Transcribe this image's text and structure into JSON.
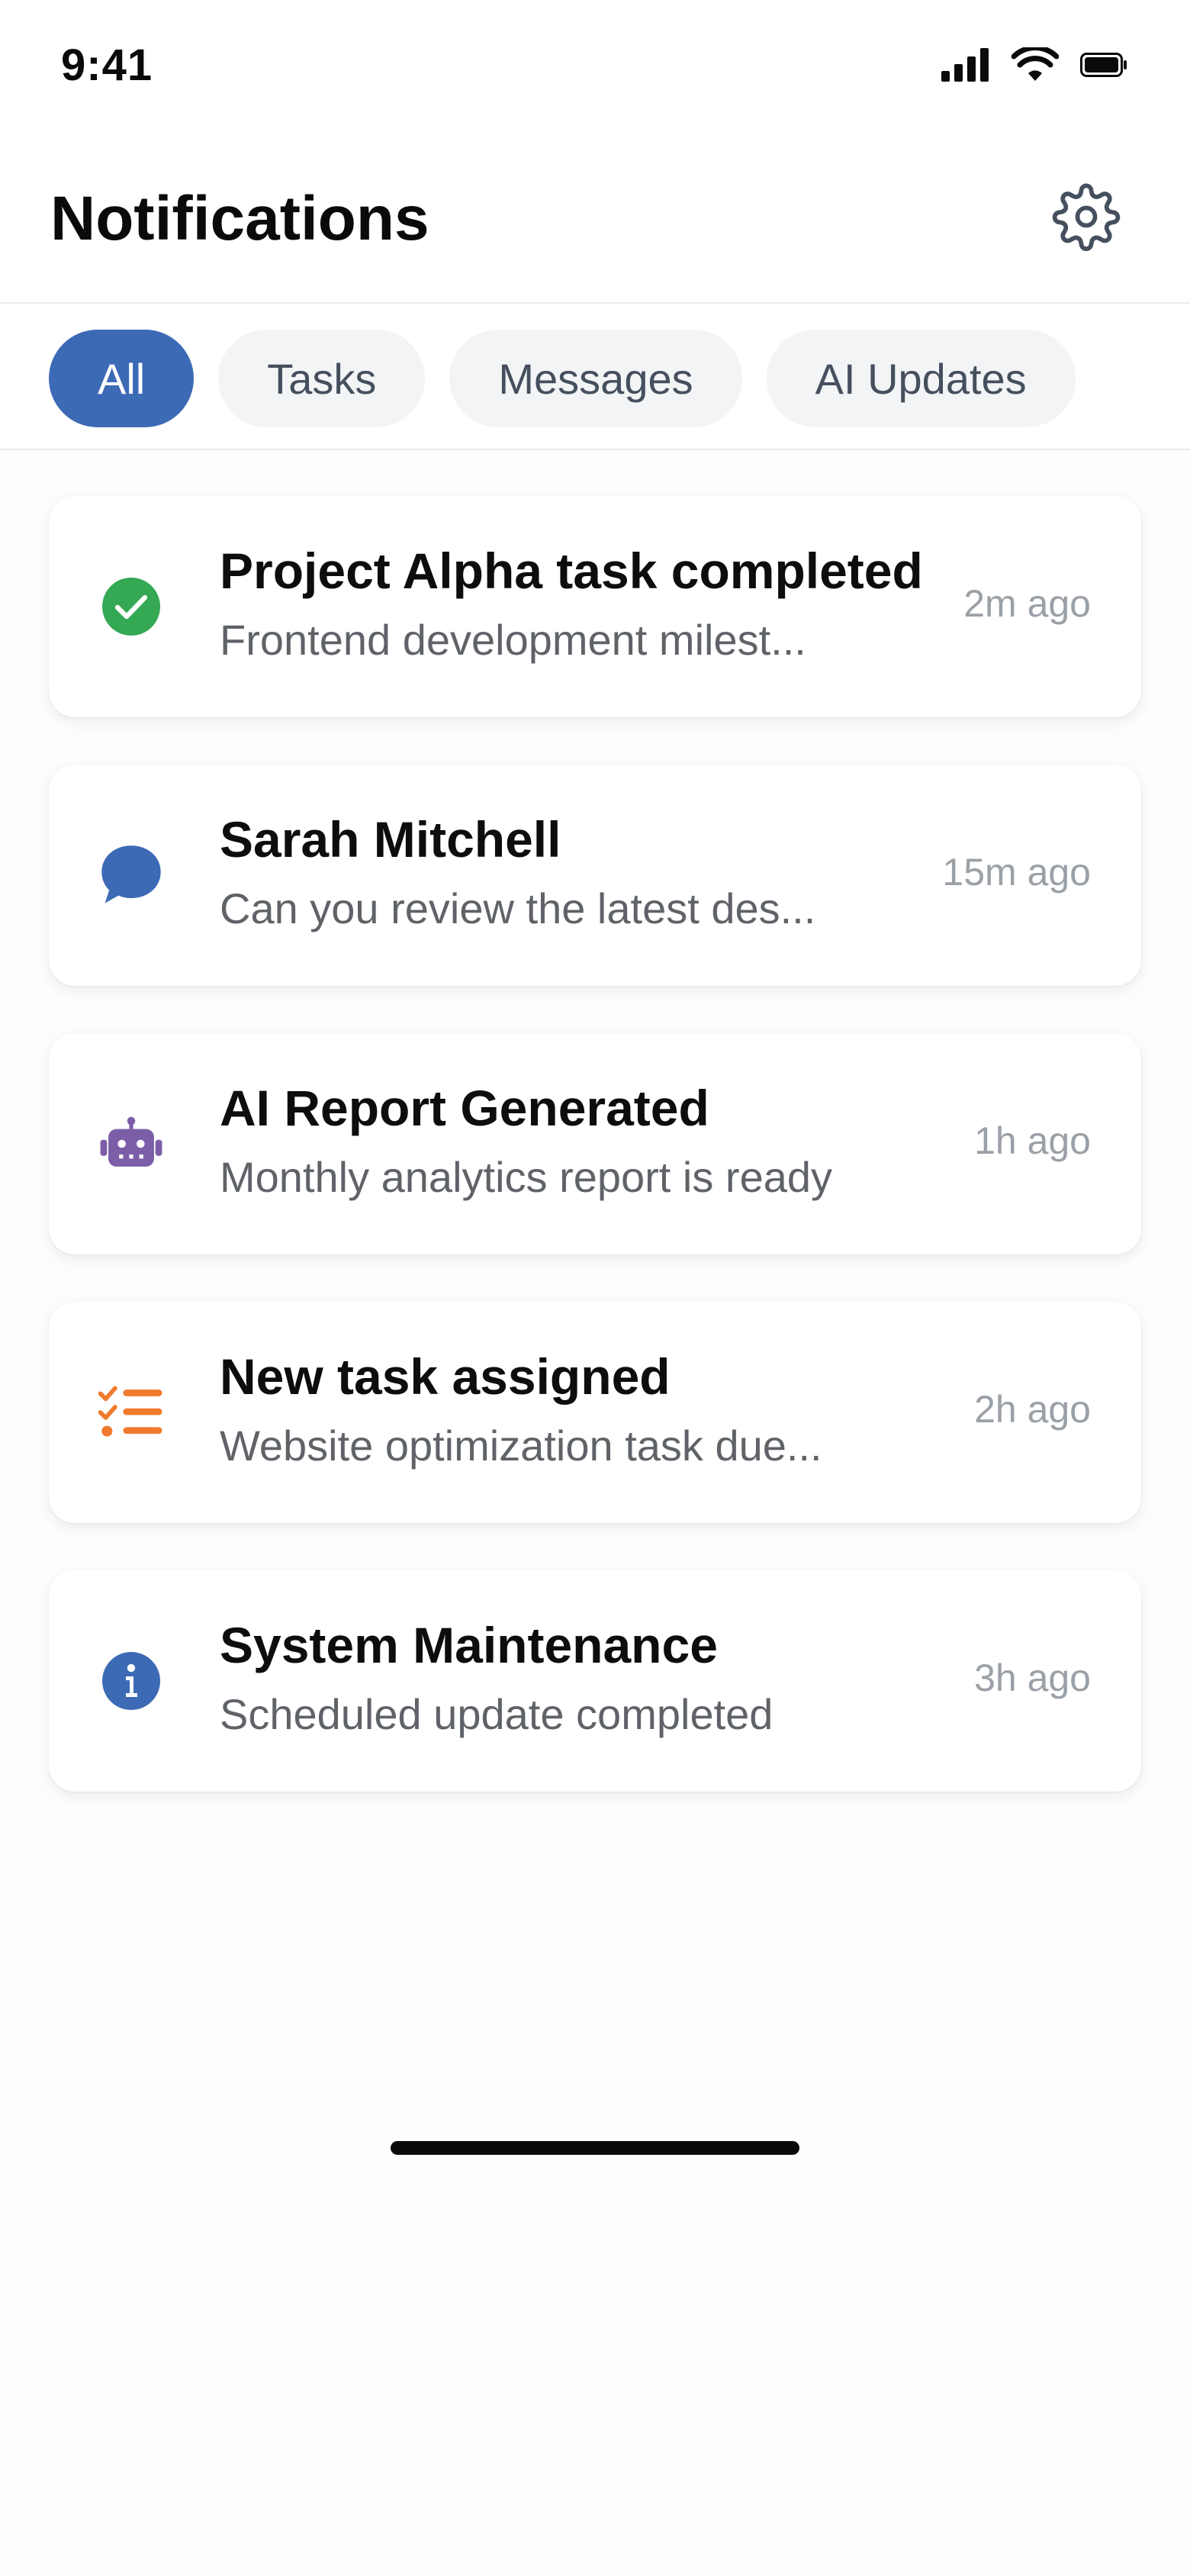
{
  "status_bar": {
    "time": "9:41",
    "icons": [
      "cellular-signal-icon",
      "wifi-icon",
      "battery-icon"
    ]
  },
  "header": {
    "title": "Notifications",
    "settings_icon": "gear-icon"
  },
  "filters": {
    "tabs": [
      {
        "label": "All",
        "active": true
      },
      {
        "label": "Tasks",
        "active": false
      },
      {
        "label": "Messages",
        "active": false
      },
      {
        "label": "AI Updates",
        "active": false
      }
    ]
  },
  "notifications": [
    {
      "icon": "check-circle-icon",
      "icon_color": "#34a853",
      "title": "Project Alpha task completed",
      "subtitle": "Frontend development milest...",
      "time": "2m ago"
    },
    {
      "icon": "chat-bubble-icon",
      "icon_color": "#3c6ab5",
      "title": "Sarah Mitchell",
      "subtitle": "Can you review the latest des...",
      "time": "15m ago"
    },
    {
      "icon": "robot-icon",
      "icon_color": "#7b5ea7",
      "title": "AI Report Generated",
      "subtitle": "Monthly analytics report is ready",
      "time": "1h ago"
    },
    {
      "icon": "task-list-icon",
      "icon_color": "#f07a2e",
      "title": "New task assigned",
      "subtitle": "Website optimization task due...",
      "time": "2h ago"
    },
    {
      "icon": "info-circle-icon",
      "icon_color": "#3c6ab5",
      "title": "System Maintenance",
      "subtitle": "Scheduled update completed",
      "time": "3h ago"
    }
  ],
  "colors": {
    "accent": "#3c6ab5",
    "tab_inactive_bg": "#f2f4f6",
    "tab_inactive_text": "#454f5e"
  }
}
